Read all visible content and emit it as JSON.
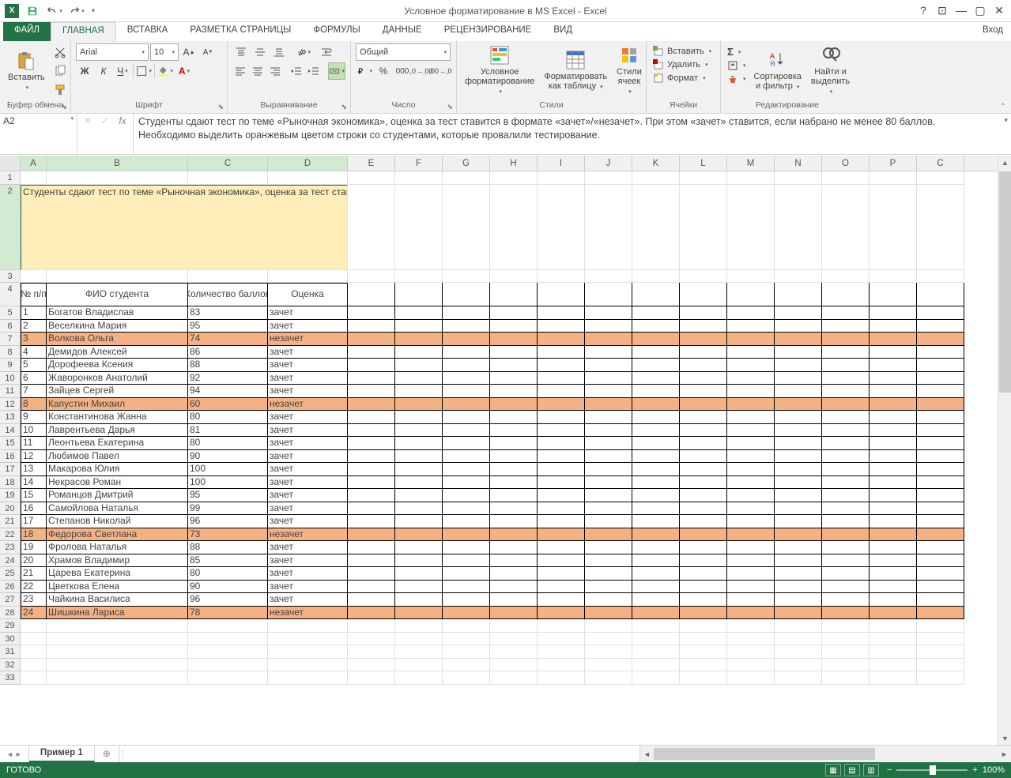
{
  "app": {
    "title": "Условное форматирование в MS Excel - Excel",
    "signin": "Вход"
  },
  "tabs": {
    "file": "ФАЙЛ",
    "home": "ГЛАВНАЯ",
    "insert": "ВСТАВКА",
    "layout": "РАЗМЕТКА СТРАНИЦЫ",
    "formulas": "ФОРМУЛЫ",
    "data": "ДАННЫЕ",
    "review": "РЕЦЕНЗИРОВАНИЕ",
    "view": "ВИД"
  },
  "ribbon": {
    "clipboard": {
      "label": "Буфер обмена",
      "paste": "Вставить"
    },
    "font": {
      "label": "Шрифт",
      "name": "Arial",
      "size": "10"
    },
    "align": {
      "label": "Выравнивание"
    },
    "number": {
      "label": "Число",
      "format": "Общий"
    },
    "styles": {
      "label": "Стили",
      "cf": "Условное форматирование",
      "ft": "Форматировать как таблицу",
      "cs": "Стили ячеек"
    },
    "cells": {
      "label": "Ячейки",
      "insert": "Вставить",
      "delete": "Удалить",
      "format": "Формат"
    },
    "editing": {
      "label": "Редактирование",
      "sort": "Сортировка и фильтр",
      "find": "Найти и выделить"
    }
  },
  "formula": {
    "cell_ref": "A2",
    "text": "Студенты сдают тест по теме «Рыночная экономика», оценка за тест ставится в формате «зачет»/«незачет». При этом «зачет» ставится, если набрано не менее 80 баллов.\nНеобходимо выделить оранжевым цветом строки со студентами, которые провалили тестирование."
  },
  "cols_std": [
    "E",
    "F",
    "G",
    "H",
    "I",
    "J",
    "K",
    "L",
    "M",
    "N",
    "O",
    "P",
    "C"
  ],
  "sheet": {
    "name": "Пример 1"
  },
  "status": {
    "ready": "ГОТОВО",
    "zoom": "100%"
  },
  "task_text": "Студенты сдают тест по теме «Рыночная экономика», оценка за тест ставится в формате «зачет»/«незачет». При этом «зачет» ставится, если набрано не менее 80 баллов.\nНеобходимо выделить оранжевым цветом строки со студентами, которые провалили тестирование.",
  "table": {
    "headers": {
      "num": "№ п/п",
      "fio": "ФИО студента",
      "score": "Количество баллов",
      "grade": "Оценка"
    },
    "rows": [
      {
        "n": "1",
        "fio": "Богатов Владислав",
        "score": "83",
        "grade": "зачет",
        "fail": false
      },
      {
        "n": "2",
        "fio": "Веселкина Мария",
        "score": "95",
        "grade": "зачет",
        "fail": false
      },
      {
        "n": "3",
        "fio": "Волкова Ольга",
        "score": "74",
        "grade": "незачет",
        "fail": true
      },
      {
        "n": "4",
        "fio": "Демидов Алексей",
        "score": "86",
        "grade": "зачет",
        "fail": false
      },
      {
        "n": "5",
        "fio": "Дорофеева Ксения",
        "score": "88",
        "grade": "зачет",
        "fail": false
      },
      {
        "n": "6",
        "fio": "Жаворонков Анатолий",
        "score": "92",
        "grade": "зачет",
        "fail": false
      },
      {
        "n": "7",
        "fio": "Зайцев Сергей",
        "score": "94",
        "grade": "зачет",
        "fail": false
      },
      {
        "n": "8",
        "fio": "Капустин Михаил",
        "score": "60",
        "grade": "незачет",
        "fail": true
      },
      {
        "n": "9",
        "fio": "Константинова Жанна",
        "score": "80",
        "grade": "зачет",
        "fail": false
      },
      {
        "n": "10",
        "fio": "Лаврентьева Дарья",
        "score": "81",
        "grade": "зачет",
        "fail": false
      },
      {
        "n": "11",
        "fio": "Леонтьева Екатерина",
        "score": "80",
        "grade": "зачет",
        "fail": false
      },
      {
        "n": "12",
        "fio": "Любимов Павел",
        "score": "90",
        "grade": "зачет",
        "fail": false
      },
      {
        "n": "13",
        "fio": "Макарова Юлия",
        "score": "100",
        "grade": "зачет",
        "fail": false
      },
      {
        "n": "14",
        "fio": "Некрасов Роман",
        "score": "100",
        "grade": "зачет",
        "fail": false
      },
      {
        "n": "15",
        "fio": "Романцов Дмитрий",
        "score": "95",
        "grade": "зачет",
        "fail": false
      },
      {
        "n": "16",
        "fio": "Самойлова Наталья",
        "score": "99",
        "grade": "зачет",
        "fail": false
      },
      {
        "n": "17",
        "fio": "Степанов Николай",
        "score": "96",
        "grade": "зачет",
        "fail": false
      },
      {
        "n": "18",
        "fio": "Федорова Светлана",
        "score": "73",
        "grade": "незачет",
        "fail": true
      },
      {
        "n": "19",
        "fio": "Фролова Наталья",
        "score": "88",
        "grade": "зачет",
        "fail": false
      },
      {
        "n": "20",
        "fio": "Храмов Владимир",
        "score": "85",
        "grade": "зачет",
        "fail": false
      },
      {
        "n": "21",
        "fio": "Царева Екатерина",
        "score": "80",
        "grade": "зачет",
        "fail": false
      },
      {
        "n": "22",
        "fio": "Цветкова Елена",
        "score": "90",
        "grade": "зачет",
        "fail": false
      },
      {
        "n": "23",
        "fio": "Чайкина Василиса",
        "score": "96",
        "grade": "зачет",
        "fail": false
      },
      {
        "n": "24",
        "fio": "Шишкина Лариса",
        "score": "78",
        "grade": "незачет",
        "fail": true
      }
    ]
  }
}
